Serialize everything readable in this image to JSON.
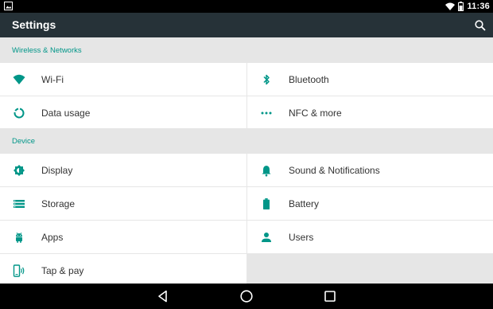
{
  "status_bar": {
    "time": "11:36",
    "icons": [
      "image-notification-icon",
      "wifi-icon",
      "battery-icon"
    ]
  },
  "app_bar": {
    "title": "Settings",
    "search_icon": "search-icon"
  },
  "sections": [
    {
      "header": "Wireless & Networks",
      "items": [
        {
          "label": "Wi-Fi",
          "icon": "wifi-icon"
        },
        {
          "label": "Bluetooth",
          "icon": "bluetooth-icon"
        },
        {
          "label": "Data usage",
          "icon": "data-usage-icon"
        },
        {
          "label": "NFC & more",
          "icon": "more-icon"
        }
      ]
    },
    {
      "header": "Device",
      "items": [
        {
          "label": "Display",
          "icon": "display-icon"
        },
        {
          "label": "Sound & Notifications",
          "icon": "bell-icon"
        },
        {
          "label": "Storage",
          "icon": "storage-icon"
        },
        {
          "label": "Battery",
          "icon": "battery-icon"
        },
        {
          "label": "Apps",
          "icon": "android-icon"
        },
        {
          "label": "Users",
          "icon": "person-icon"
        },
        {
          "label": "Tap & pay",
          "icon": "tap-pay-icon"
        }
      ]
    }
  ],
  "nav_bar": {
    "buttons": [
      "back-icon",
      "home-icon",
      "recents-icon"
    ]
  },
  "colors": {
    "accent": "#009688",
    "app_bar": "#263238",
    "background": "#e6e6e6"
  }
}
